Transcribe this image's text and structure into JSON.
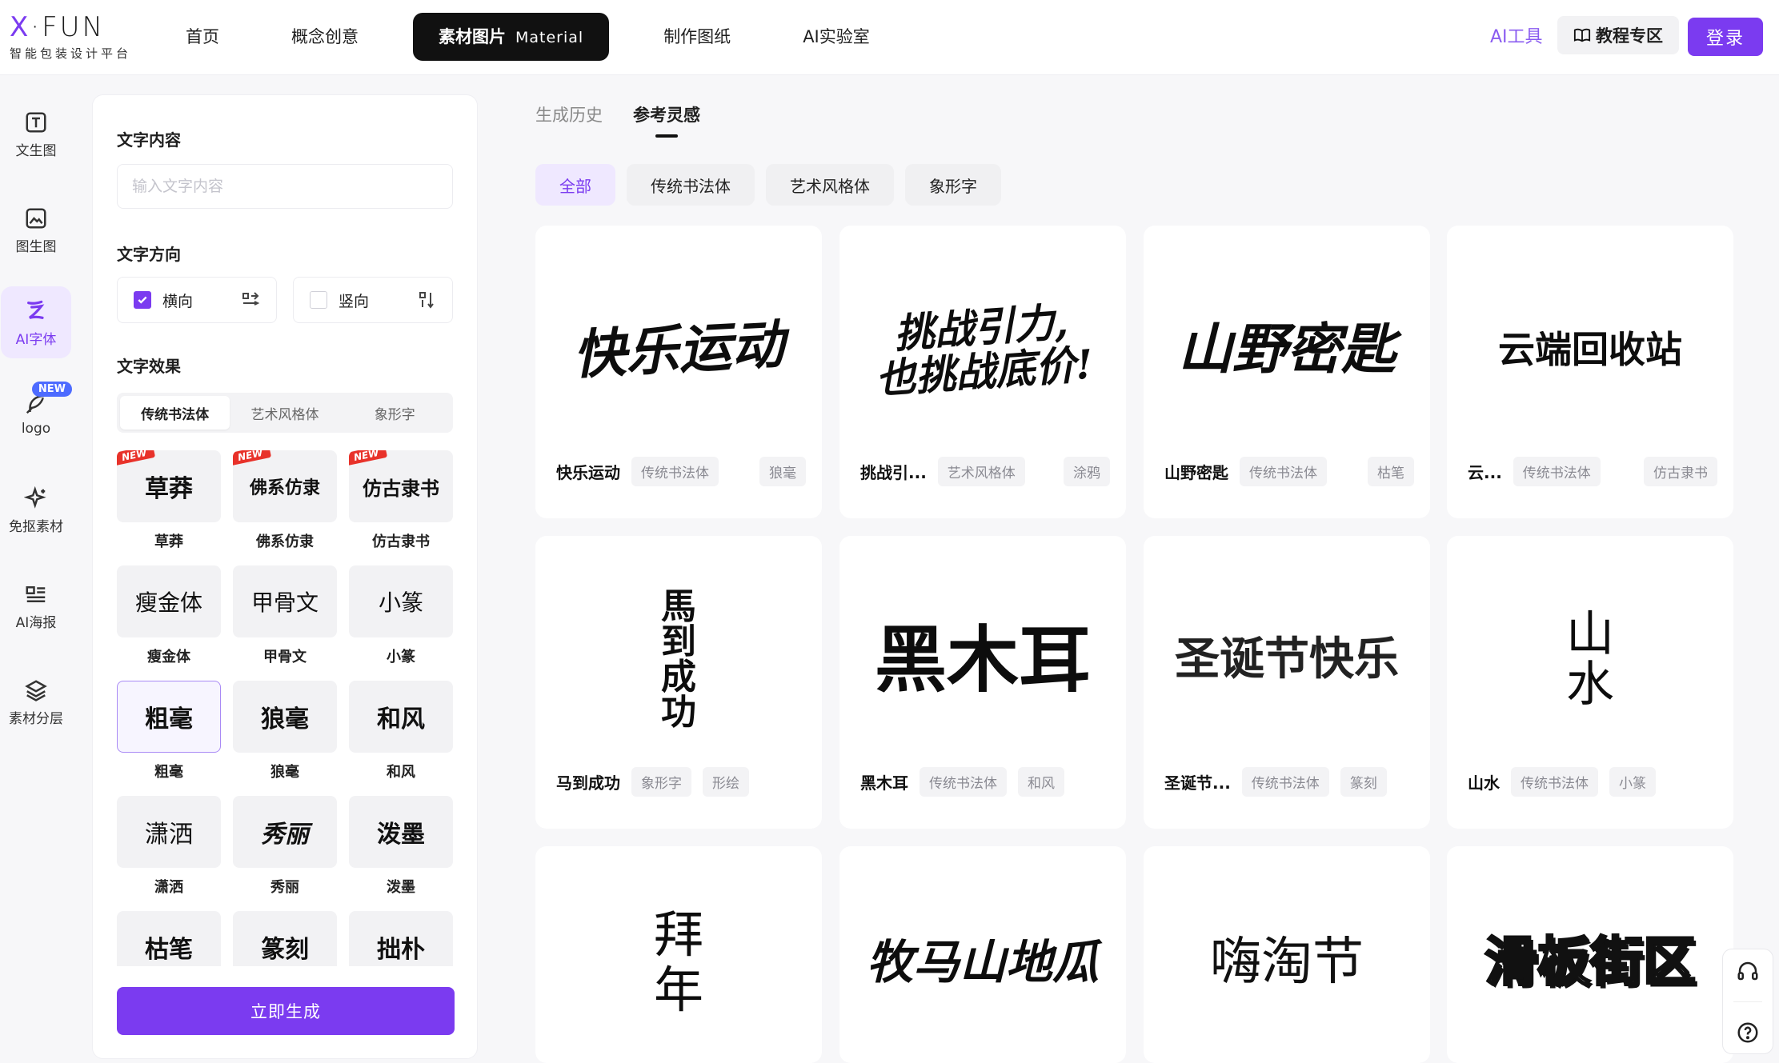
{
  "header": {
    "logo": {
      "brand": "X·FUN",
      "brand_x": "X",
      "brand_rest": "·FUN",
      "subtitle": "智能包装设计平台"
    },
    "nav": [
      {
        "label": "首页"
      },
      {
        "label": "概念创意"
      },
      {
        "label": "素材图片",
        "en": "Material",
        "active": true
      },
      {
        "label": "制作图纸"
      },
      {
        "label": "AI实验室"
      }
    ],
    "ai_tools": "AI工具",
    "tutorial": "教程专区",
    "login": "登录"
  },
  "rail": [
    {
      "label": "文生图",
      "icon": "text-t-icon"
    },
    {
      "label": "图生图",
      "icon": "image-icon"
    },
    {
      "label": "AI字体",
      "icon": "ai-font-icon",
      "active": true
    },
    {
      "label": "logo",
      "icon": "feather-icon",
      "badge": "NEW"
    },
    {
      "label": "免抠素材",
      "icon": "sparkle-icon"
    },
    {
      "label": "AI海报",
      "icon": "poster-icon"
    },
    {
      "label": "素材分层",
      "icon": "layers-icon"
    }
  ],
  "panel": {
    "content_label": "文字内容",
    "content_placeholder": "输入文字内容",
    "content_value": "",
    "direction_label": "文字方向",
    "horizontal": "横向",
    "vertical": "竖向",
    "horizontal_checked": true,
    "effect_label": "文字效果",
    "effect_tabs": [
      "传统书法体",
      "艺术风格体",
      "象形字"
    ],
    "styles": [
      {
        "name": "草莽",
        "thumb": "草莽",
        "new": "NEW"
      },
      {
        "name": "佛系仿隶",
        "thumb": "佛系仿隶",
        "new": "NEW"
      },
      {
        "name": "仿古隶书",
        "thumb": "仿古隶书",
        "new": "NEW"
      },
      {
        "name": "瘦金体",
        "thumb": "瘦金体"
      },
      {
        "name": "甲骨文",
        "thumb": "甲骨文"
      },
      {
        "name": "小篆",
        "thumb": "小篆"
      },
      {
        "name": "粗毫",
        "thumb": "粗毫",
        "selected": true
      },
      {
        "name": "狼毫",
        "thumb": "狼毫"
      },
      {
        "name": "和风",
        "thumb": "和风"
      },
      {
        "name": "潇洒",
        "thumb": "潇洒"
      },
      {
        "name": "秀丽",
        "thumb": "秀丽"
      },
      {
        "name": "泼墨",
        "thumb": "泼墨"
      },
      {
        "name": "枯笔",
        "thumb": "枯笔"
      },
      {
        "name": "篆刻",
        "thumb": "篆刻"
      },
      {
        "name": "拙朴",
        "thumb": "拙朴"
      }
    ],
    "generate": "立即生成"
  },
  "main": {
    "tabs": [
      {
        "label": "生成历史"
      },
      {
        "label": "参考灵感",
        "active": true
      }
    ],
    "filters": [
      {
        "label": "全部",
        "active": true
      },
      {
        "label": "传统书法体"
      },
      {
        "label": "艺术风格体"
      },
      {
        "label": "象形字"
      }
    ],
    "cards": [
      {
        "art": "快乐运动",
        "title": "快乐运动",
        "tags": [
          "传统书法体",
          "狼毫"
        ]
      },
      {
        "art": "挑战引力,\n也挑战底价!",
        "title": "挑战引...",
        "tags": [
          "艺术风格体",
          "涂鸦"
        ]
      },
      {
        "art": "山野密匙",
        "title": "山野密匙",
        "tags": [
          "传统书法体",
          "枯笔"
        ]
      },
      {
        "art": "云端回收站",
        "title": "云...",
        "tags": [
          "传统书法体",
          "仿古隶书"
        ]
      },
      {
        "art": "馬\n到\n成\n功",
        "title": "马到成功",
        "tags": [
          "象形字",
          "形绘"
        ]
      },
      {
        "art": "黑木耳",
        "title": "黑木耳",
        "tags": [
          "传统书法体",
          "和风"
        ]
      },
      {
        "art": "圣诞节快乐",
        "title": "圣诞节...",
        "tags": [
          "传统书法体",
          "篆刻"
        ]
      },
      {
        "art": "山\n水",
        "title": "山水",
        "tags": [
          "传统书法体",
          "小篆"
        ]
      },
      {
        "art": "拜\n年",
        "title": "",
        "tags": []
      },
      {
        "art": "牧马山地瓜",
        "title": "",
        "tags": []
      },
      {
        "art": "嗨淘节",
        "title": "",
        "tags": []
      },
      {
        "art": "滑板街区",
        "title": "",
        "tags": []
      }
    ]
  },
  "colors": {
    "accent": "#7b3bf0",
    "accent_soft": "#efe8ff",
    "new_badge": "#4d6bff",
    "ribbon": "#e8322a"
  }
}
